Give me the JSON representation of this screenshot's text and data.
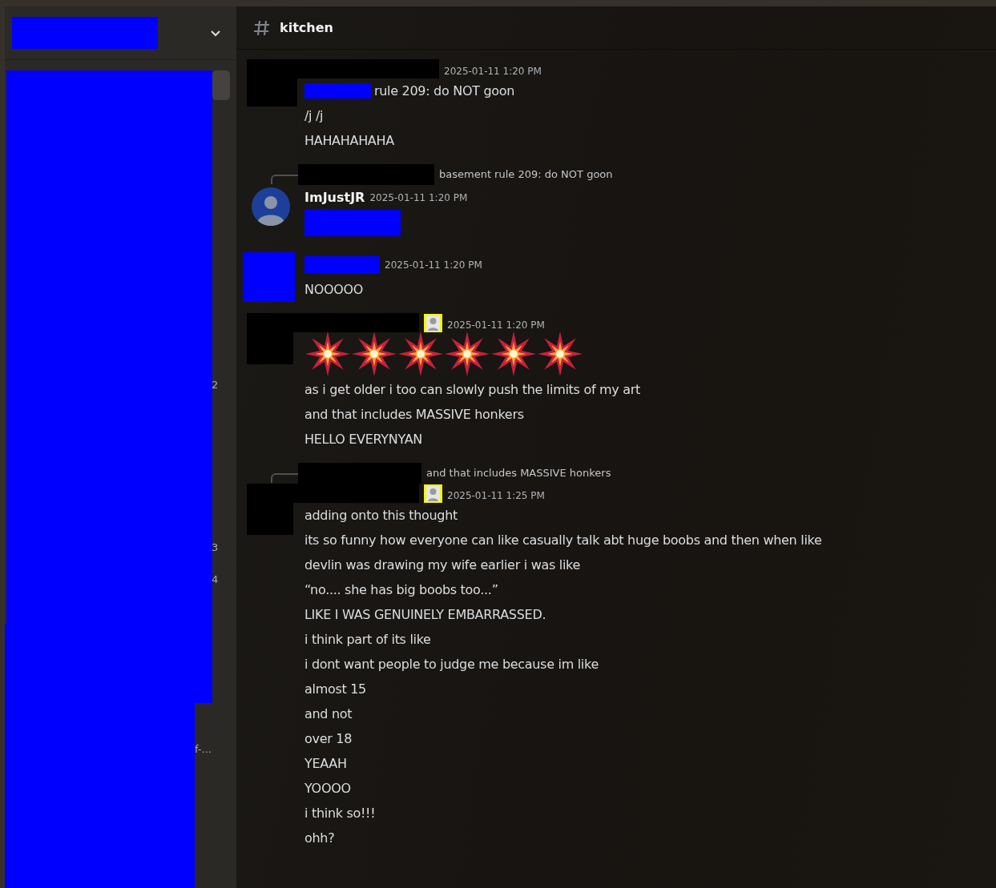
{
  "sidebar": {
    "header": {
      "redacted": true
    },
    "fragments": [
      {
        "text": "2"
      },
      {
        "text": "3"
      },
      {
        "text": "4"
      },
      {
        "text": "f-..."
      }
    ]
  },
  "channel": {
    "name": "kitchen"
  },
  "messages": [
    {
      "author": {
        "kind": "redacted_black"
      },
      "avatar": {
        "kind": "redacted_black"
      },
      "badge": false,
      "timestamp": "2025-01-11 1:20 PM",
      "lines": [
        {
          "kind": "text",
          "redacted_prefix": true,
          "text": "rule 209: do NOT goon"
        },
        {
          "kind": "text",
          "redacted_prefix": false,
          "text": "/j /j"
        },
        {
          "kind": "text",
          "redacted_prefix": false,
          "text": "HAHAHAHAHA"
        }
      ]
    },
    {
      "reply": {
        "text": "basement rule 209: do NOT goon"
      },
      "author": {
        "kind": "named",
        "name": "ImJustJR"
      },
      "avatar": {
        "kind": "photo"
      },
      "badge": false,
      "timestamp": "2025-01-11 1:20 PM",
      "lines": [
        {
          "kind": "redacted"
        }
      ]
    },
    {
      "author": {
        "kind": "redacted_blue"
      },
      "avatar": {
        "kind": "redacted_blue"
      },
      "badge": false,
      "timestamp": "2025-01-11 1:20 PM",
      "lines": [
        {
          "kind": "text",
          "redacted_prefix": false,
          "text": "NOOOOO"
        }
      ]
    },
    {
      "author": {
        "kind": "redacted_black"
      },
      "avatar": {
        "kind": "redacted_black"
      },
      "badge": true,
      "timestamp": "2025-01-11 1:20 PM",
      "lines": [
        {
          "kind": "emoji_row",
          "emojis": [
            {
              "kind": "explosion"
            },
            {
              "kind": "explosion"
            },
            {
              "kind": "explosion"
            },
            {
              "kind": "explosion"
            },
            {
              "kind": "explosion"
            },
            {
              "kind": "explosion"
            }
          ]
        },
        {
          "kind": "text",
          "redacted_prefix": false,
          "text": "as i get older i too can slowly push the limits of my art"
        },
        {
          "kind": "text",
          "redacted_prefix": false,
          "text": "and that includes MASSIVE honkers"
        },
        {
          "kind": "text",
          "redacted_prefix": false,
          "text": "HELLO EVERYNYAN"
        }
      ]
    },
    {
      "reply": {
        "text": "and that includes MASSIVE honkers"
      },
      "author": {
        "kind": "redacted_black"
      },
      "avatar": {
        "kind": "redacted_black"
      },
      "badge": true,
      "timestamp": "2025-01-11 1:25 PM",
      "lines": [
        {
          "kind": "text",
          "redacted_prefix": false,
          "text": "adding onto this thought"
        },
        {
          "kind": "text",
          "redacted_prefix": false,
          "text": "its so funny how everyone can like casually talk abt huge boobs and then when like"
        },
        {
          "kind": "text",
          "redacted_prefix": false,
          "text": "devlin was drawing my wife earlier i was like"
        },
        {
          "kind": "text",
          "redacted_prefix": false,
          "text": "“no.... she has big boobs too...”"
        },
        {
          "kind": "text",
          "redacted_prefix": false,
          "text": "LIKE I WAS GENUINELY EMBARRASSED."
        },
        {
          "kind": "text",
          "redacted_prefix": false,
          "text": "i think part of its like"
        },
        {
          "kind": "text",
          "redacted_prefix": false,
          "text": "i dont want people to judge me because im like"
        },
        {
          "kind": "text",
          "redacted_prefix": false,
          "text": "almost 15"
        },
        {
          "kind": "text",
          "redacted_prefix": false,
          "text": "and not"
        },
        {
          "kind": "text",
          "redacted_prefix": false,
          "text": "over 18"
        },
        {
          "kind": "text",
          "redacted_prefix": false,
          "text": "YEAAH"
        },
        {
          "kind": "text",
          "redacted_prefix": false,
          "text": "YOOOO"
        },
        {
          "kind": "text",
          "redacted_prefix": false,
          "text": "i think so!!!"
        },
        {
          "kind": "text",
          "redacted_prefix": false,
          "text": "ohh?"
        }
      ]
    }
  ]
}
